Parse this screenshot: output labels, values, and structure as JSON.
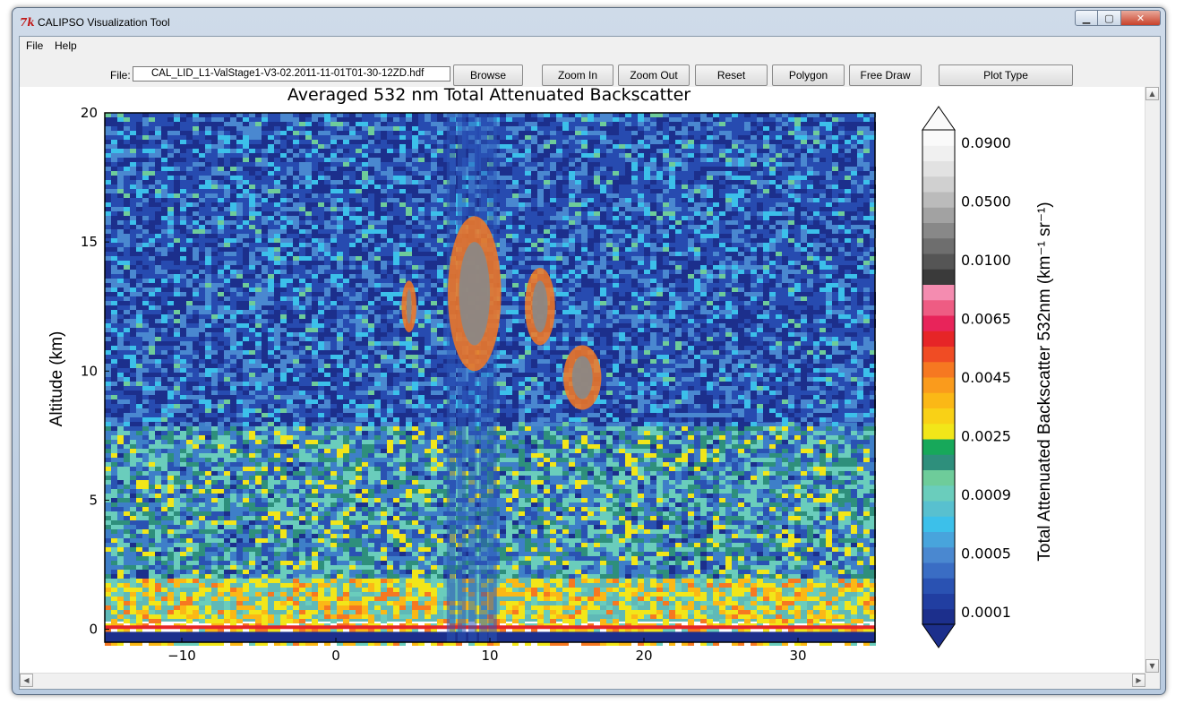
{
  "window": {
    "title": "CALIPSO Visualization Tool",
    "icon": "tk-feather-icon"
  },
  "menubar": {
    "items": [
      "File",
      "Help"
    ]
  },
  "toolbar": {
    "file_label": "File:",
    "file_value": "CAL_LID_L1-ValStage1-V3-02.2011-11-01T01-30-12ZD.hdf",
    "buttons": [
      "Browse",
      "Zoom In",
      "Zoom Out",
      "Reset",
      "Polygon",
      "Free Draw",
      "Plot Type"
    ]
  },
  "chart_data": {
    "type": "heatmap",
    "title": "Averaged 532 nm Total Attenuated Backscatter",
    "xlabel": "",
    "ylabel": "Altitude (km)",
    "xlim": [
      -15,
      35
    ],
    "ylim": [
      -0.5,
      20
    ],
    "x_ticks": [
      -10,
      0,
      10,
      20,
      30
    ],
    "y_ticks": [
      0,
      5,
      10,
      15,
      20
    ],
    "colorbar": {
      "label": "Total Attenuated Backscatter 532nm (km⁻¹ sr⁻¹)",
      "tick_labels": [
        "0.0900",
        "0.0500",
        "0.0100",
        "0.0065",
        "0.0045",
        "0.0025",
        "0.0009",
        "0.0005",
        "0.0001"
      ],
      "colors": [
        "#1c2f8c",
        "#213ea1",
        "#2a52b2",
        "#3a6dc4",
        "#4a88d0",
        "#48a4dc",
        "#3cc0ea",
        "#58c0cf",
        "#6acdbc",
        "#6ecc9a",
        "#2e8f7c",
        "#17a85a",
        "#f2e619",
        "#f9d116",
        "#fbb816",
        "#fa9b1c",
        "#f67821",
        "#f04c24",
        "#e62527",
        "#e8245a",
        "#ee5c83",
        "#f48cb0",
        "#3a3a3a",
        "#555555",
        "#6e6e6e",
        "#888888",
        "#a2a2a2",
        "#bbbbbb",
        "#d0d0d0",
        "#e2e2e2",
        "#f0f0f0",
        "#fafafa"
      ],
      "extend": "both"
    },
    "features": [
      {
        "name": "surface return",
        "x": [
          -15,
          35
        ],
        "altitude_km": 0
      },
      {
        "name": "boundary layer aerosol",
        "x": [
          -15,
          35
        ],
        "altitude_km": [
          0,
          2
        ]
      },
      {
        "name": "cirrus cloud",
        "x": [
          4.5,
          5.0
        ],
        "altitude_km": [
          11.5,
          13.5
        ]
      },
      {
        "name": "cirrus cloud",
        "x": [
          7.5,
          10.5
        ],
        "altitude_km": [
          10,
          16
        ]
      },
      {
        "name": "cirrus cloud",
        "x": [
          12.5,
          14
        ],
        "altitude_km": [
          11,
          14
        ]
      },
      {
        "name": "cirrus cloud",
        "x": [
          15,
          17
        ],
        "altitude_km": [
          8.5,
          11
        ]
      }
    ]
  }
}
